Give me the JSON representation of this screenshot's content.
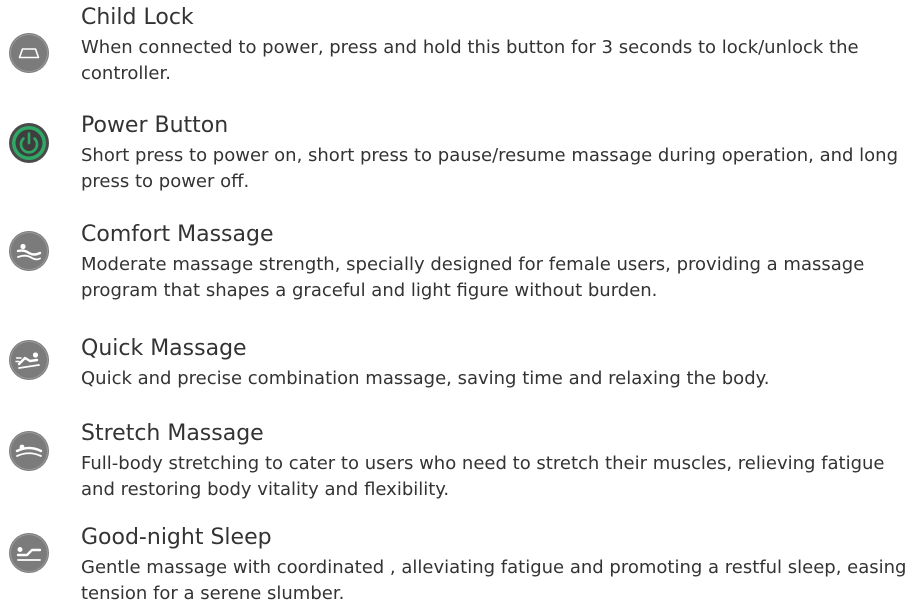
{
  "items": [
    {
      "icon": "child-lock-icon",
      "title": "Child Lock",
      "description": "When connected to power, press and hold this button for 3 seconds to lock/unlock the controller."
    },
    {
      "icon": "power-icon",
      "title": "Power Button",
      "description": "Short press to power on, short press to pause/resume massage during operation, and long press to power off."
    },
    {
      "icon": "comfort-massage-icon",
      "title": "Comfort Massage",
      "description": "Moderate massage strength, specially designed for female users, providing a massage program that shapes a graceful and light figure without burden."
    },
    {
      "icon": "quick-massage-icon",
      "title": "Quick Massage",
      "description": "Quick and precise combination massage, saving time and relaxing the body."
    },
    {
      "icon": "stretch-massage-icon",
      "title": "Stretch Massage",
      "description": "Full-body stretching to cater to users who need to stretch their muscles, relieving fatigue and restoring body vitality and flexibility."
    },
    {
      "icon": "good-night-sleep-icon",
      "title": "Good-night Sleep",
      "description": "Gentle massage with coordinated , alleviating fatigue and promoting a restful sleep, easing tension for a serene slumber."
    }
  ],
  "colors": {
    "icon_grey": "#7b7b7b",
    "icon_dark": "#5a5a5a",
    "power_green": "#2fa866",
    "text": "#333333"
  }
}
